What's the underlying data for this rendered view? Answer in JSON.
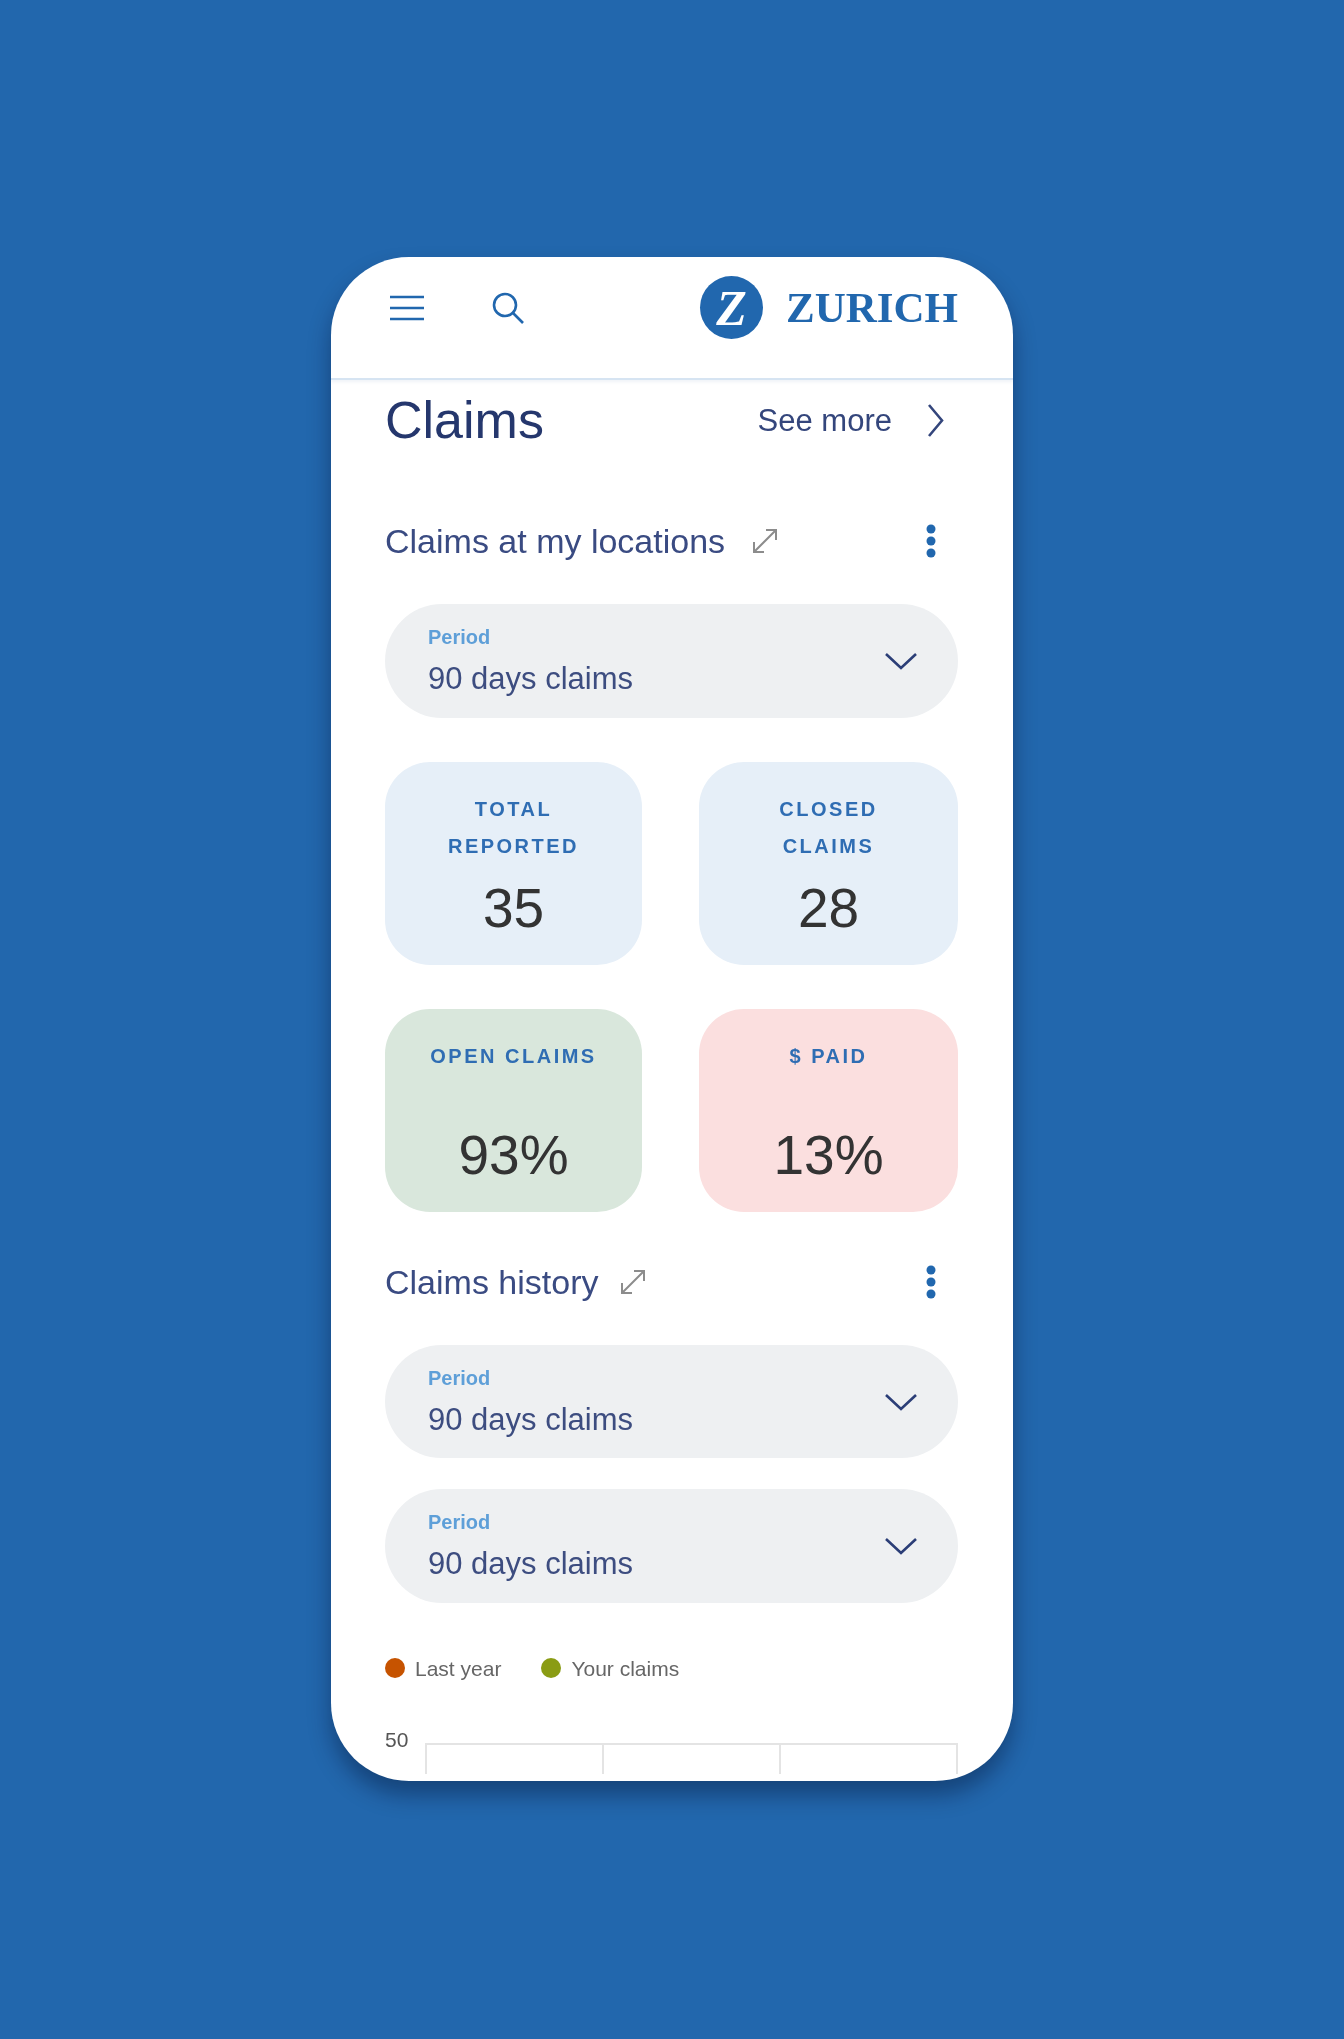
{
  "header": {
    "logo_mark": "Z",
    "logo_text": "ZURICH"
  },
  "title": "Claims",
  "see_more": "See more",
  "locations": {
    "title": "Claims at my locations",
    "period": {
      "label": "Period",
      "value": "90 days claims"
    },
    "stats": [
      {
        "label": "TOTAL REPORTED",
        "value": "35",
        "color": "#e6eff8"
      },
      {
        "label": "CLOSED CLAIMS",
        "value": "28",
        "color": "#e6eff8"
      },
      {
        "label": "OPEN CLAIMS",
        "value": "93%",
        "color": "#d9e7dc"
      },
      {
        "label": "$ PAID",
        "value": "13%",
        "color": "#fbdfdf"
      }
    ]
  },
  "history": {
    "title": "Claims history",
    "filters": [
      {
        "label": "Period",
        "value": "90 days claims"
      },
      {
        "label": "Period",
        "value": "90 days claims"
      }
    ],
    "legend": [
      {
        "label": "Last year",
        "color": "#c65300"
      },
      {
        "label": "Your claims",
        "color": "#8a9c14"
      }
    ],
    "y_tick_labels": [
      "50"
    ]
  }
}
